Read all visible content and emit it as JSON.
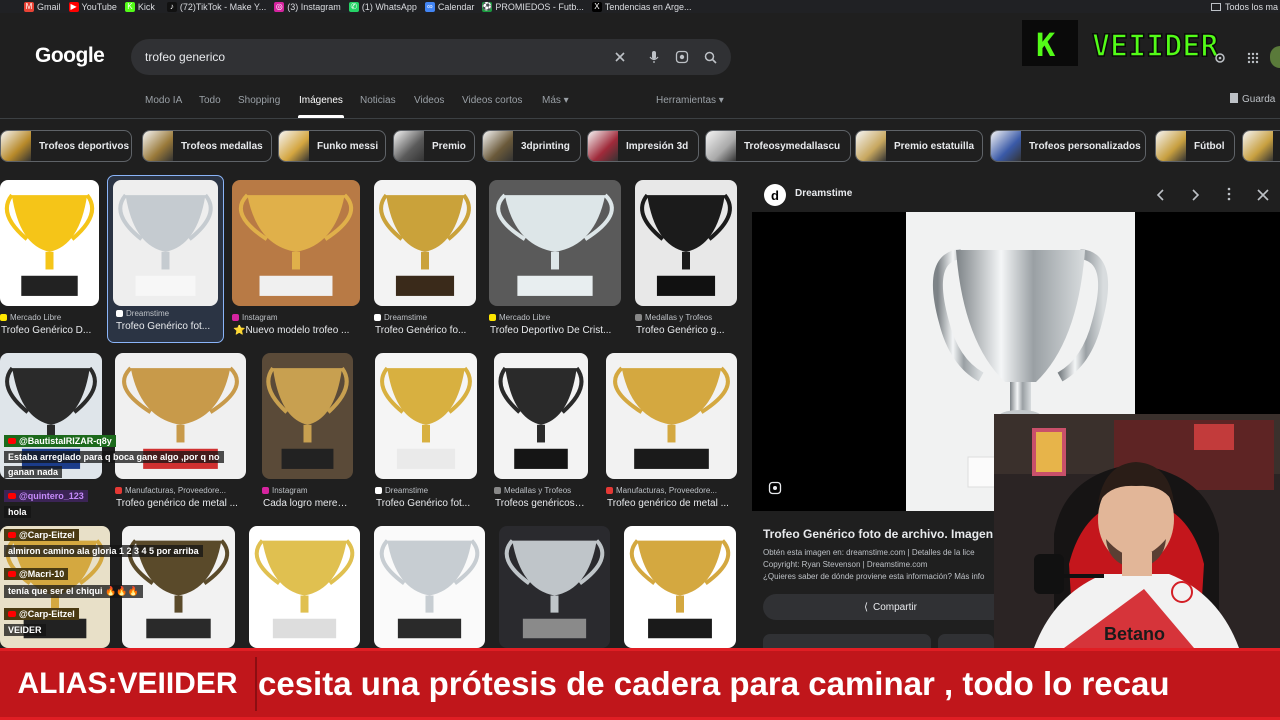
{
  "bookmarks": [
    {
      "label": "Gmail",
      "color": "#ea4335",
      "glyph": "M"
    },
    {
      "label": "YouTube",
      "color": "#ff0000",
      "glyph": "▶"
    },
    {
      "label": "Kick",
      "color": "#53fc18",
      "glyph": "K"
    },
    {
      "label": "(72)TikTok - Make Y...",
      "color": "#111111",
      "glyph": "♪"
    },
    {
      "label": "(3) Instagram",
      "color": "#d6249f",
      "glyph": "◎"
    },
    {
      "label": "(1) WhatsApp",
      "color": "#25d366",
      "glyph": "✆"
    },
    {
      "label": "Calendar",
      "color": "#4285f4",
      "glyph": "∞"
    },
    {
      "label": "PROMIEDOS - Futb...",
      "color": "#1a9c3e",
      "glyph": "⚽"
    },
    {
      "label": "Tendencias en Arge...",
      "color": "#000000",
      "glyph": "X"
    }
  ],
  "bookmarks_right": "Todos los ma",
  "google": {
    "logo": "Google"
  },
  "search": {
    "value": "trofeo generico"
  },
  "tabs": [
    {
      "label": "Modo IA",
      "active": false
    },
    {
      "label": "Todo",
      "active": false
    },
    {
      "label": "Shopping",
      "active": false
    },
    {
      "label": "Imágenes",
      "active": true
    },
    {
      "label": "Noticias",
      "active": false
    },
    {
      "label": "Videos",
      "active": false
    },
    {
      "label": "Videos cortos",
      "active": false
    },
    {
      "label": "Más ▾",
      "active": false
    },
    {
      "label": "Herramientas ▾",
      "active": false
    }
  ],
  "saved_label": "Guarda",
  "chips": [
    "Trofeos deportivos",
    "Trofeos medallas",
    "Funko messi",
    "Premio",
    "3dprinting",
    "Impresión 3d",
    "Trofeosymedallascu",
    "Premio estatuilla",
    "Trofeos personalizados",
    "Fútbol"
  ],
  "results_row1": [
    {
      "source": "Mercado Libre",
      "title": "Trofeo Genérico D...",
      "source_color": "#ffe600"
    },
    {
      "source": "Dreamstime",
      "title": "Trofeo Genérico fot...",
      "source_color": "#ffffff"
    },
    {
      "source": "Instagram",
      "title": "⭐Nuevo modelo trofeo ...",
      "source_color": "#d6249f"
    },
    {
      "source": "Dreamstime",
      "title": "Trofeo Genérico fo...",
      "source_color": "#ffffff"
    },
    {
      "source": "Mercado Libre",
      "title": "Trofeo Deportivo De Crist...",
      "source_color": "#ffe600"
    },
    {
      "source": "Medallas y Trofeos",
      "title": "Trofeo Genérico g...",
      "source_color": "#888888"
    }
  ],
  "results_row2": [
    {
      "source": "Manufacturas, Proveedore...",
      "title": "Trofeo genérico de metal ...",
      "source_color": "#e53935"
    },
    {
      "source": "Instagram",
      "title": "Cada logro merece...",
      "source_color": "#d6249f"
    },
    {
      "source": "Dreamstime",
      "title": "Trofeo Genérico fot...",
      "source_color": "#ffffff"
    },
    {
      "source": "Medallas y Trofeos",
      "title": "Trofeos genéricos ...",
      "source_color": "#888888"
    },
    {
      "source": "Manufacturas, Proveedore...",
      "title": "Trofeo genérico de metal ...",
      "source_color": "#e53935"
    }
  ],
  "panel": {
    "source": "Dreamstime",
    "title": "Trofeo Genérico foto de archivo. Imagen",
    "meta_line1": "Obtén esta imagen en: dreamstime.com | Detalles de la lice",
    "meta_line2": "Copyright: Ryan Stevenson | Dreamstime.com",
    "meta_line3": "¿Quieres saber de dónde proviene esta información? Más info",
    "share_label": "Compartir"
  },
  "chat": [
    {
      "user": "@BautistaIRIZAR-q8y",
      "message": "Estaba arreglado para q boca gane algo ,por q no"
    },
    {
      "user": "",
      "message": "ganan nada"
    },
    {
      "user": "@quintero_123",
      "message": "hola"
    },
    {
      "user": "@Carp-Eitzel",
      "message": "almiron camino ala gloria 1 2 3 4 5 por arriba"
    },
    {
      "user": "@Macri-10",
      "message": "tenía que ser el chiqui 🔥🔥🔥"
    },
    {
      "user": "@Carp-Eitzel",
      "message": "VEIDER"
    }
  ],
  "overlay": {
    "brand": "VEIIDER",
    "brand_k": "K",
    "alias": "ALIAS:VEIIDER",
    "ticker": "cesita una prótesis de cadera para caminar , todo lo recau"
  },
  "colors": {
    "accent": "#53fc18",
    "ticker_bg": "#c0161b"
  }
}
